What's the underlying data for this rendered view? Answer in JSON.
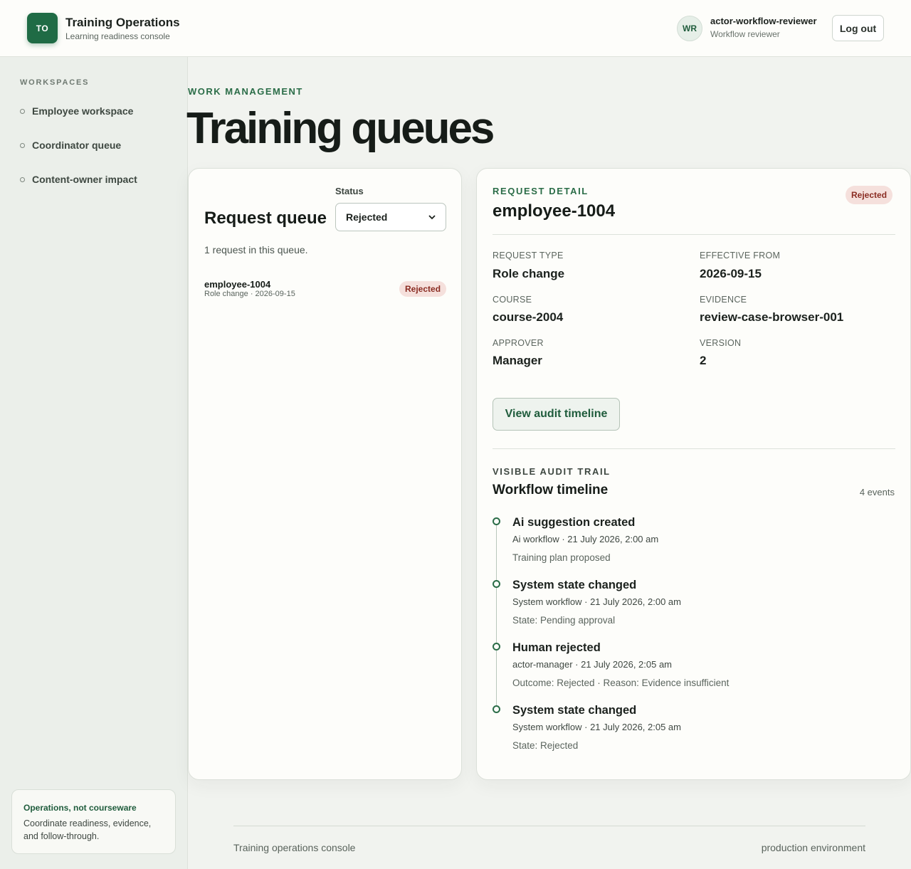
{
  "header": {
    "badge": "TO",
    "title": "Training Operations",
    "subtitle": "Learning readiness console",
    "user_initials": "WR",
    "user_name": "actor-workflow-reviewer",
    "user_role": "Workflow reviewer",
    "logout_label": "Log out"
  },
  "sidebar": {
    "heading": "WORKSPACES",
    "items": [
      {
        "label": "Employee workspace"
      },
      {
        "label": "Coordinator queue"
      },
      {
        "label": "Content-owner impact"
      }
    ],
    "card": {
      "title": "Operations, not courseware",
      "text": "Coordinate readiness, evidence, and follow-through."
    }
  },
  "main": {
    "eyebrow": "WORK MANAGEMENT",
    "title": "Training queues"
  },
  "queue": {
    "status_label": "Status",
    "status_value": "Rejected",
    "title": "Request queue",
    "count_text": "1 request in this queue.",
    "items": [
      {
        "id": "employee-1004",
        "meta": "Role change · 2026-09-15",
        "status": "Rejected"
      }
    ]
  },
  "detail": {
    "eyebrow": "REQUEST DETAIL",
    "id": "employee-1004",
    "status": "Rejected",
    "fields": {
      "request_type_label": "REQUEST TYPE",
      "request_type": "Role change",
      "effective_from_label": "EFFECTIVE FROM",
      "effective_from": "2026-09-15",
      "course_label": "COURSE",
      "course": "course-2004",
      "evidence_label": "EVIDENCE",
      "evidence": "review-case-browser-001",
      "approver_label": "APPROVER",
      "approver": "Manager",
      "version_label": "VERSION",
      "version": "2"
    },
    "audit_button": "View audit timeline",
    "trail_eyebrow": "VISIBLE AUDIT TRAIL",
    "trail_title": "Workflow timeline",
    "trail_count": "4 events",
    "events": [
      {
        "title": "Ai suggestion created",
        "meta": "Ai workflow · 21 July 2026, 2:00 am",
        "note": "Training plan proposed"
      },
      {
        "title": "System state changed",
        "meta": "System workflow · 21 July 2026, 2:00 am",
        "note": "State: Pending approval"
      },
      {
        "title": "Human rejected",
        "meta": "actor-manager · 21 July 2026, 2:05 am",
        "note": "Outcome: Rejected · Reason: Evidence insufficient"
      },
      {
        "title": "System state changed",
        "meta": "System workflow · 21 July 2026, 2:05 am",
        "note": "State: Rejected"
      }
    ]
  },
  "footer": {
    "left": "Training operations console",
    "right": "production environment"
  },
  "colors": {
    "accent": "#1f6b45",
    "badge_rejected_bg": "#f5e0dc",
    "badge_rejected_text": "#8a2c22"
  }
}
